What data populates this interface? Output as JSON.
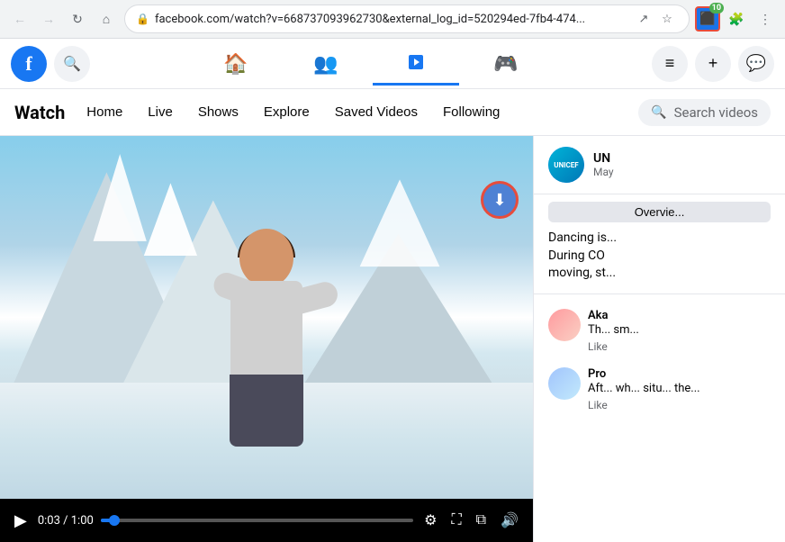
{
  "browser": {
    "back_disabled": true,
    "forward_disabled": true,
    "url": "facebook.com/watch?v=668737093962730&external_log_id=520294ed-7fb4-474...",
    "extension_badge": "10",
    "nav_arrows": [
      "←",
      "→",
      "↻",
      "⌂"
    ]
  },
  "facebook": {
    "logo_letter": "f",
    "nav_items": [
      {
        "icon": "🏠",
        "label": "Home",
        "active": false
      },
      {
        "icon": "👥",
        "label": "Friends",
        "active": false
      },
      {
        "icon": "▶",
        "label": "Watch",
        "active": true
      },
      {
        "icon": "🎮",
        "label": "Gaming",
        "active": false
      }
    ],
    "menu_icon": "≡",
    "plus_icon": "+",
    "messenger_icon": "💬"
  },
  "watch": {
    "title": "Watch",
    "nav_items": [
      {
        "label": "Home"
      },
      {
        "label": "Live"
      },
      {
        "label": "Shows"
      },
      {
        "label": "Explore"
      },
      {
        "label": "Saved Videos"
      },
      {
        "label": "Following"
      }
    ],
    "search_placeholder": "Search videos"
  },
  "video": {
    "time_current": "0:03",
    "time_total": "1:00",
    "progress_percent": 5
  },
  "sidebar": {
    "channel": {
      "name": "UN",
      "date": "May",
      "overview_label": "Overvie..."
    },
    "description_lines": [
      "Dancing is...",
      "During CO",
      "moving, st..."
    ],
    "comments": [
      {
        "name": "Aka",
        "text": "Th... sm...",
        "action": "Like"
      },
      {
        "name": "Pro",
        "text": "Aft... wh... situ... the...",
        "action": "Like"
      }
    ]
  },
  "controls": {
    "play_icon": "▶",
    "settings_icon": "⚙",
    "fullscreen_icon": "⛶",
    "pip_icon": "⧉",
    "volume_icon": "🔊",
    "download_icon": "⬇"
  }
}
